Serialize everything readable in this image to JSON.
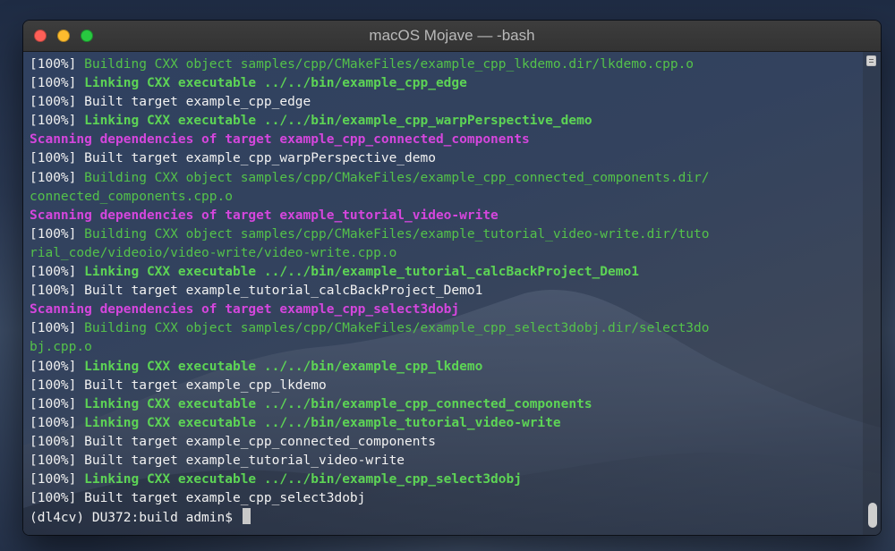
{
  "window": {
    "title": "macOS Mojave — -bash"
  },
  "colors": {
    "close": "#fe5f57",
    "minimize": "#febc2e",
    "maximize": "#28c840",
    "output_green": "#54c24a",
    "scanning_magenta": "#d546dd",
    "plain_text": "#f2f2f2"
  },
  "terminal": {
    "lines": [
      {
        "prefix": "[100%] ",
        "text": "Building CXX object samples/cpp/CMakeFiles/example_cpp_lkdemo.dir/lkdemo.cpp.o",
        "style": "green"
      },
      {
        "prefix": "[100%] ",
        "text": "Linking CXX executable ../../bin/example_cpp_edge",
        "style": "green-bold"
      },
      {
        "prefix": "[100%] ",
        "text": "Built target example_cpp_edge",
        "style": "white"
      },
      {
        "prefix": "[100%] ",
        "text": "Linking CXX executable ../../bin/example_cpp_warpPerspective_demo",
        "style": "green-bold"
      },
      {
        "prefix": "",
        "text": "Scanning dependencies of target example_cpp_connected_components",
        "style": "magenta"
      },
      {
        "prefix": "[100%] ",
        "text": "Built target example_cpp_warpPerspective_demo",
        "style": "white"
      },
      {
        "prefix": "[100%] ",
        "text": "Building CXX object samples/cpp/CMakeFiles/example_cpp_connected_components.dir/",
        "style": "green"
      },
      {
        "prefix": "",
        "text": "connected_components.cpp.o",
        "style": "green"
      },
      {
        "prefix": "",
        "text": "Scanning dependencies of target example_tutorial_video-write",
        "style": "magenta"
      },
      {
        "prefix": "[100%] ",
        "text": "Building CXX object samples/cpp/CMakeFiles/example_tutorial_video-write.dir/tuto",
        "style": "green"
      },
      {
        "prefix": "",
        "text": "rial_code/videoio/video-write/video-write.cpp.o",
        "style": "green"
      },
      {
        "prefix": "[100%] ",
        "text": "Linking CXX executable ../../bin/example_tutorial_calcBackProject_Demo1",
        "style": "green-bold"
      },
      {
        "prefix": "[100%] ",
        "text": "Built target example_tutorial_calcBackProject_Demo1",
        "style": "white"
      },
      {
        "prefix": "",
        "text": "Scanning dependencies of target example_cpp_select3dobj",
        "style": "magenta"
      },
      {
        "prefix": "[100%] ",
        "text": "Building CXX object samples/cpp/CMakeFiles/example_cpp_select3dobj.dir/select3do",
        "style": "green"
      },
      {
        "prefix": "",
        "text": "bj.cpp.o",
        "style": "green"
      },
      {
        "prefix": "[100%] ",
        "text": "Linking CXX executable ../../bin/example_cpp_lkdemo",
        "style": "green-bold"
      },
      {
        "prefix": "[100%] ",
        "text": "Built target example_cpp_lkdemo",
        "style": "white"
      },
      {
        "prefix": "[100%] ",
        "text": "Linking CXX executable ../../bin/example_cpp_connected_components",
        "style": "green-bold"
      },
      {
        "prefix": "[100%] ",
        "text": "Linking CXX executable ../../bin/example_tutorial_video-write",
        "style": "green-bold"
      },
      {
        "prefix": "[100%] ",
        "text": "Built target example_cpp_connected_components",
        "style": "white"
      },
      {
        "prefix": "[100%] ",
        "text": "Built target example_tutorial_video-write",
        "style": "white"
      },
      {
        "prefix": "[100%] ",
        "text": "Linking CXX executable ../../bin/example_cpp_select3dobj",
        "style": "green-bold"
      },
      {
        "prefix": "[100%] ",
        "text": "Built target example_cpp_select3dobj",
        "style": "white"
      }
    ],
    "prompt": "(dl4cv) DU372:build admin$ "
  }
}
